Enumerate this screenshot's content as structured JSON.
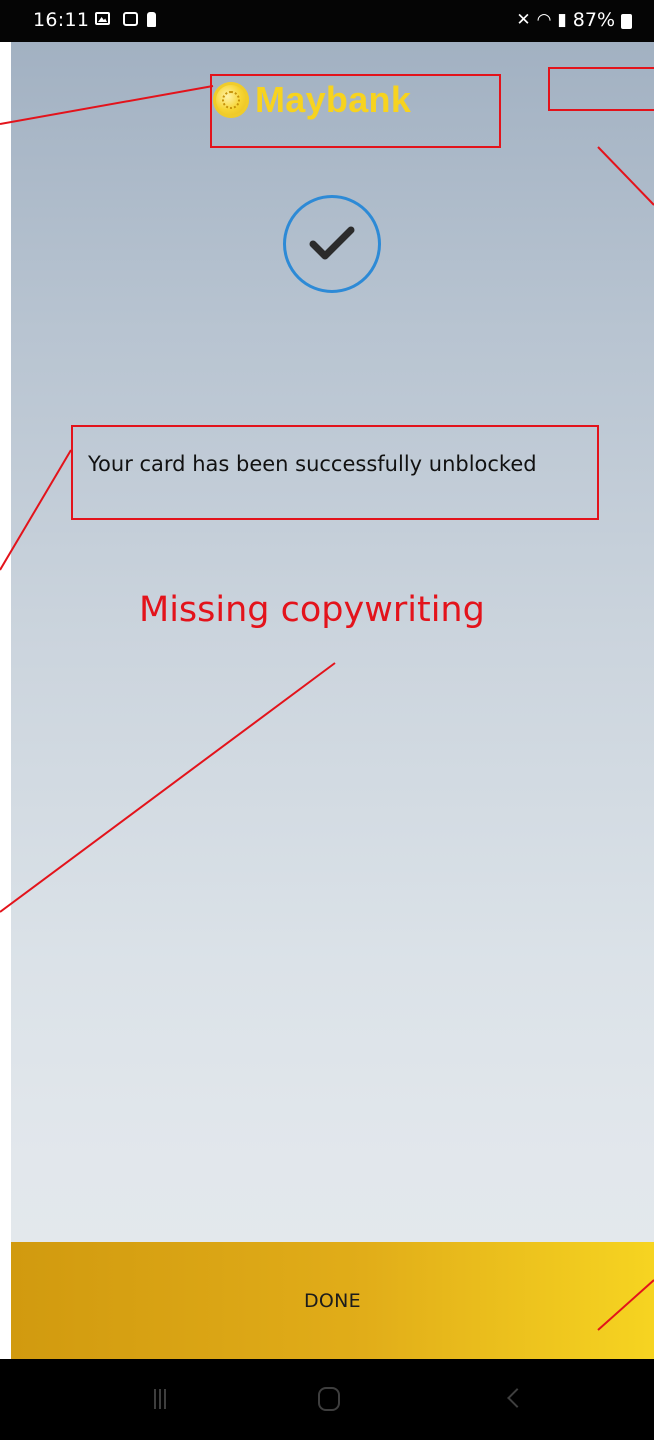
{
  "status_bar": {
    "time": "16:11",
    "battery": "87%",
    "icons": [
      "gallery-icon",
      "screenshot-icon",
      "person-icon",
      "mute-icon",
      "wifi-icon",
      "signal-icon",
      "battery-icon"
    ]
  },
  "logo": {
    "text": "Maybank",
    "color": "#f7d31f"
  },
  "success_icon": "check-circle-icon",
  "message": "Your card has been successfully unblocked",
  "done_button": {
    "label": "DONE"
  },
  "nav_bar": {
    "icons": [
      "recent-apps-icon",
      "home-icon",
      "back-icon"
    ]
  },
  "annotation": {
    "label": "Missing copywriting",
    "color": "#e3131b"
  },
  "colors": {
    "accent_blue": "#2d8ad6",
    "button_gold": "#e1ad19",
    "annotation_red": "#e3131b"
  }
}
